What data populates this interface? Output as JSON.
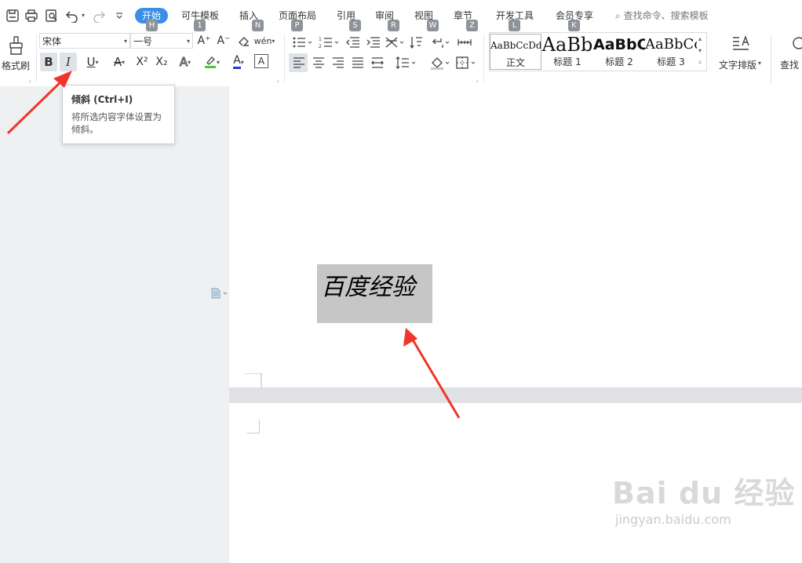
{
  "toolbar": {
    "quick_icons": [
      "save-icon",
      "print-icon",
      "print-preview-icon",
      "undo-icon",
      "redo-icon",
      "customize-icon"
    ],
    "tabs": [
      {
        "label": "开始",
        "key": "H",
        "active": true
      },
      {
        "label": "可牛模板",
        "key": "1"
      },
      {
        "label": "插入",
        "key": "N"
      },
      {
        "label": "页面布局",
        "key": "P"
      },
      {
        "label": "引用",
        "key": "S"
      },
      {
        "label": "审阅",
        "key": "R"
      },
      {
        "label": "视图",
        "key": "W"
      },
      {
        "label": "章节",
        "key": "Z"
      },
      {
        "label": "开发工具",
        "key": "L"
      },
      {
        "label": "会员专享",
        "key": "K"
      }
    ],
    "search_placeholder": "查找命令、搜索模板"
  },
  "ribbon": {
    "format_painter_label": "格式刷",
    "font_name": "宋体",
    "font_size": "一号",
    "bold": "B",
    "italic": "I",
    "underline": "U",
    "strikethrough": "A",
    "superscript": "X²",
    "subscript": "X₂",
    "text_effect": "A",
    "highlight": "A",
    "font_color": "A",
    "char_border": "A",
    "grow_font": "A⁺",
    "shrink_font": "A⁻",
    "phonetic": "wén",
    "styles": [
      {
        "preview": "AaBbCcDd",
        "name": "正文"
      },
      {
        "preview": "AaBb",
        "name": "标题 1"
      },
      {
        "preview": "AaBbC",
        "name": "标题 2"
      },
      {
        "preview": "AaBbCc",
        "name": "标题 3"
      }
    ],
    "text_layout_label": "文字排版",
    "find_label": "查找",
    "colors": {
      "highlight": "#3fcf2f",
      "font_color": "#1f3dd4",
      "accent": "#3a8ee6",
      "arrow": "#f0352a"
    }
  },
  "tooltip": {
    "title": "倾斜 (Ctrl+I)",
    "description": "将所选内容字体设置为倾斜。"
  },
  "document": {
    "selected_text": "百度经验"
  },
  "watermark": {
    "brand": "Bai du 经验",
    "url": "jingyan.baidu.com"
  }
}
